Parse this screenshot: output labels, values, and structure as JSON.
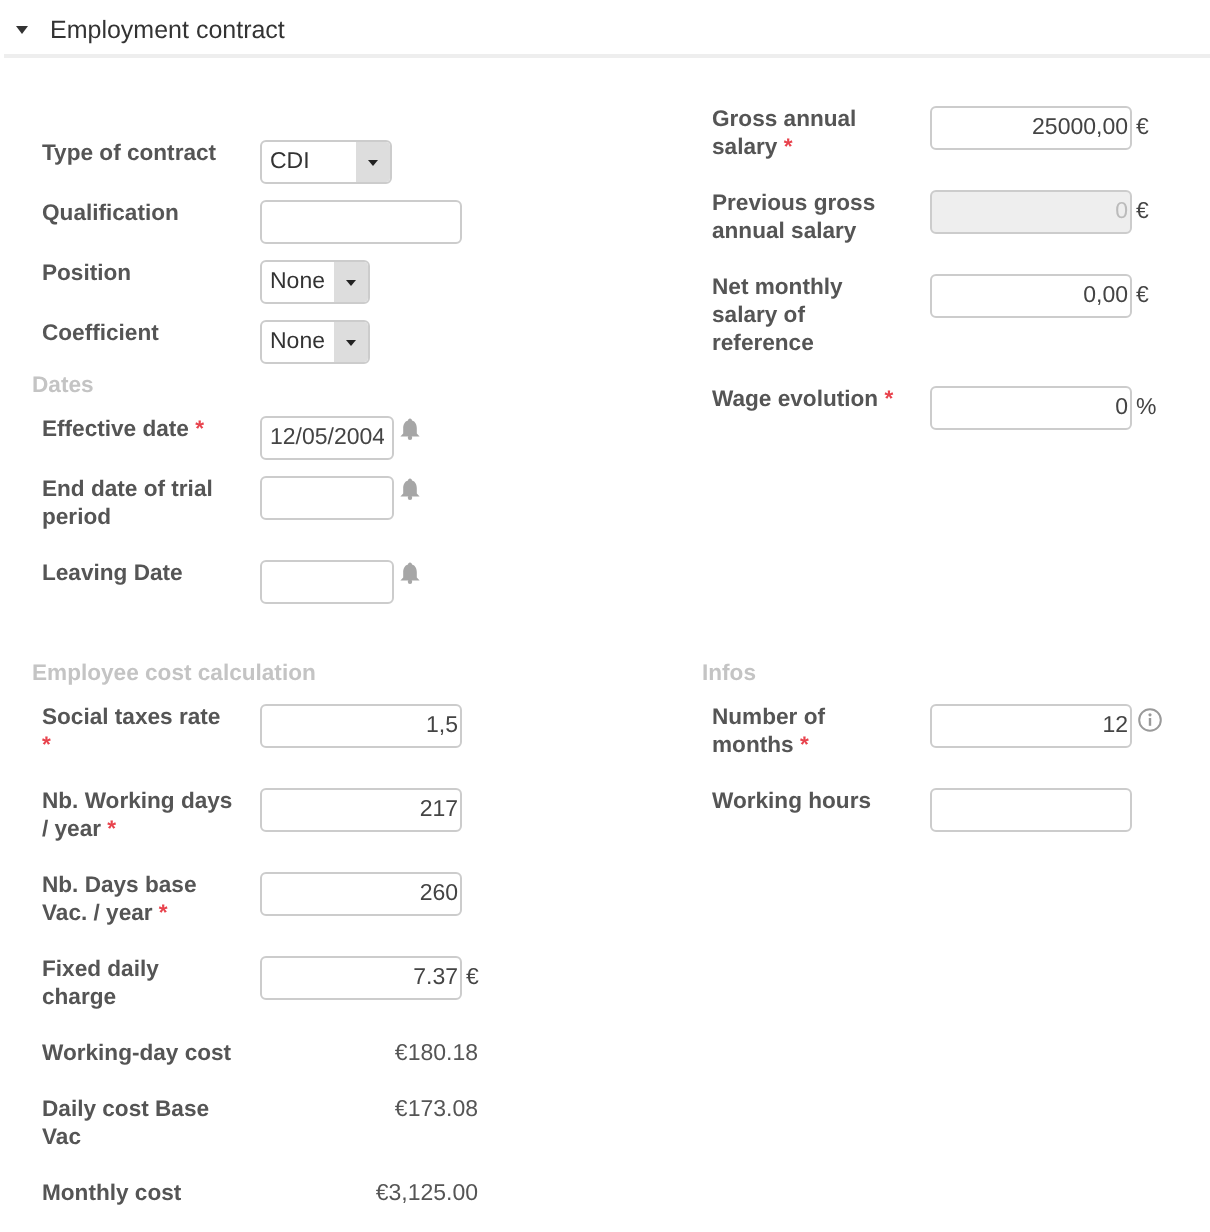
{
  "section": {
    "title": "Employment contract",
    "expanded": true
  },
  "contract": {
    "fields": [
      {
        "kind": "select",
        "label": "Type of contract",
        "value": "CDI"
      },
      {
        "kind": "text",
        "label": "Qualification"
      },
      {
        "kind": "select",
        "label": "Position",
        "value": "None"
      },
      {
        "kind": "select",
        "label": "Coefficient",
        "value": "None"
      }
    ]
  },
  "dates": {
    "title": "Dates",
    "fields": [
      {
        "kind": "date",
        "label": "Effective date",
        "required_mark": "*",
        "value": "12/05/2004"
      },
      {
        "kind": "date",
        "label": "End date of trial period"
      },
      {
        "kind": "date",
        "label": "Leaving Date"
      }
    ]
  },
  "salary": {
    "fields": [
      {
        "kind": "number",
        "label": "Gross annual salary",
        "required_mark": "*",
        "value": "25000,00",
        "unit": "€",
        "disabled": false
      },
      {
        "kind": "number",
        "label": "Previous gross annual salary",
        "value": "0",
        "unit": "€",
        "disabled": true
      },
      {
        "kind": "number",
        "label": "Net monthly salary of reference",
        "value": "0,00",
        "unit": "€",
        "disabled": false
      },
      {
        "kind": "number",
        "label": "Wage evolution",
        "required_mark": "*",
        "value": "0",
        "unit": "%",
        "disabled": false
      }
    ]
  },
  "cost": {
    "title": "Employee cost calculation",
    "fields": [
      {
        "kind": "number",
        "label": "Social taxes rate",
        "required_mark": "*",
        "value": "1,5"
      },
      {
        "kind": "number",
        "label": "Nb. Working days / year",
        "required_mark": "*",
        "value": "217"
      },
      {
        "kind": "number",
        "label": "Nb. Days base Vac. / year",
        "required_mark": "*",
        "value": "260"
      },
      {
        "kind": "number",
        "label": "Fixed daily charge",
        "value": "7.37",
        "unit": "€"
      },
      {
        "kind": "readout",
        "label": "Working-day cost",
        "value": "€180.18"
      },
      {
        "kind": "readout",
        "label": "Daily cost Base Vac",
        "value": "€173.08"
      },
      {
        "kind": "readout",
        "label": "Monthly cost",
        "value": "€3,125.00"
      }
    ]
  },
  "infos": {
    "title": "Infos",
    "fields": [
      {
        "kind": "number",
        "label": "Number of months",
        "required_mark": "*",
        "value": "12",
        "info": true
      },
      {
        "kind": "number",
        "label": "Working hours",
        "info": false
      }
    ]
  }
}
